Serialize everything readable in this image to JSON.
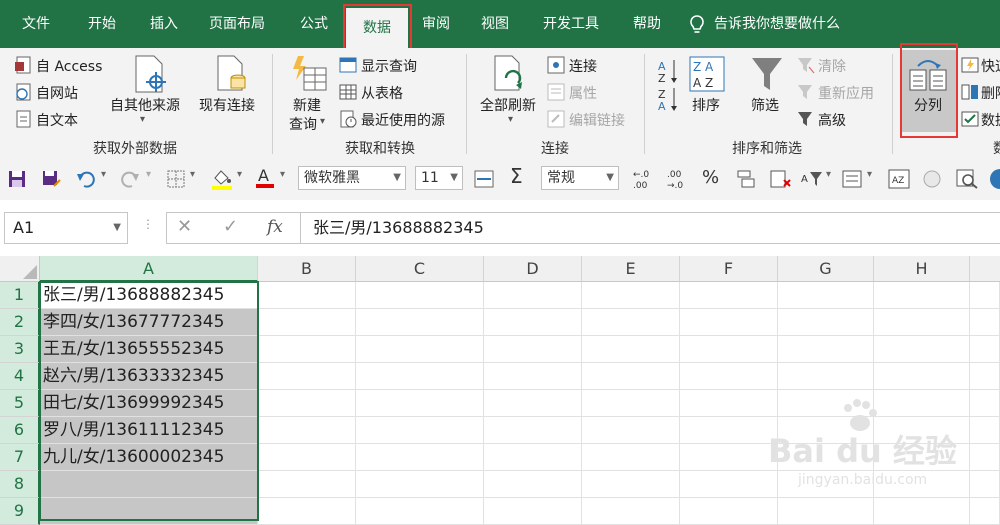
{
  "tabs": [
    "文件",
    "开始",
    "插入",
    "页面布局",
    "公式",
    "数据",
    "审阅",
    "视图",
    "开发工具",
    "帮助"
  ],
  "active_tab": "数据",
  "tellme": "告诉我你想要做什么",
  "ribbon": {
    "external": {
      "access": "自 Access",
      "web": "自网站",
      "text": "自文本",
      "other": "自其他来源",
      "existing": "现有连接",
      "group": "获取外部数据"
    },
    "transform": {
      "new_query_1": "新建",
      "new_query_2": "查询",
      "show_queries": "显示查询",
      "from_table": "从表格",
      "recent": "最近使用的源",
      "group": "获取和转换"
    },
    "connections": {
      "refresh_all": "全部刷新",
      "connections": "连接",
      "properties": "属性",
      "edit_links": "编辑链接",
      "group": "连接"
    },
    "sort": {
      "sort": "排序",
      "filter": "筛选",
      "clear": "清除",
      "reapply": "重新应用",
      "advanced": "高级",
      "group": "排序和筛选"
    },
    "tools": {
      "split": "分列",
      "flash": "快速",
      "remove": "删除",
      "validate": "数据",
      "group": "数"
    }
  },
  "qat": {
    "font": "微软雅黑",
    "size": "11",
    "number_format": "常规"
  },
  "formula_bar": {
    "name_box": "A1",
    "fx": "fx",
    "content": "张三/男/13688882345"
  },
  "columns": [
    "A",
    "B",
    "C",
    "D",
    "E",
    "F",
    "G",
    "H"
  ],
  "rows": [
    "1",
    "2",
    "3",
    "4",
    "5",
    "6",
    "7",
    "8",
    "9"
  ],
  "cells_A": [
    "张三/男/13688882345",
    "李四/女/13677772345",
    "王五/女/13655552345",
    "赵六/男/13633332345",
    "田七/女/13699992345",
    "罗八/男/13611112345",
    "九儿/女/13600002345",
    "",
    ""
  ],
  "watermark": {
    "brand": "Bai du 经验",
    "url": "jingyan.baidu.com"
  }
}
